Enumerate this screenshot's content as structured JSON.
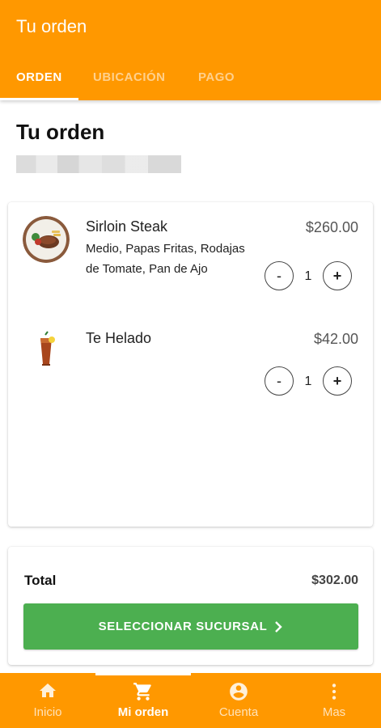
{
  "app_bar": {
    "title": "Tu orden"
  },
  "tabs": [
    {
      "label": "ORDEN",
      "active": true
    },
    {
      "label": "UBICACIÓN",
      "active": false
    },
    {
      "label": "PAGO",
      "active": false
    }
  ],
  "order": {
    "heading": "Tu orden",
    "items": [
      {
        "name": "Sirloin Steak",
        "modifiers": "Medio, Papas Fritas, Rodajas de Tomate, Pan de Ajo",
        "price": "$260.00",
        "quantity": "1",
        "image_icon": "steak-plate-image"
      },
      {
        "name": "Te Helado",
        "modifiers": "",
        "price": "$42.00",
        "quantity": "1",
        "image_icon": "iced-tea-image"
      }
    ],
    "qty_minus_label": "-",
    "qty_plus_label": "+"
  },
  "summary": {
    "total_label": "Total",
    "total_value": "$302.00",
    "cta_label": "SELECCIONAR SUCURSAL"
  },
  "bottom_nav": [
    {
      "label": "Inicio",
      "icon": "home-icon",
      "active": false
    },
    {
      "label": "Mi orden",
      "icon": "cart-icon",
      "active": true
    },
    {
      "label": "Cuenta",
      "icon": "account-icon",
      "active": false
    },
    {
      "label": "Mas",
      "icon": "more-vert-icon",
      "active": false
    }
  ],
  "colors": {
    "primary": "#FF9800",
    "cta": "#4CAF50",
    "text": "#222222"
  }
}
